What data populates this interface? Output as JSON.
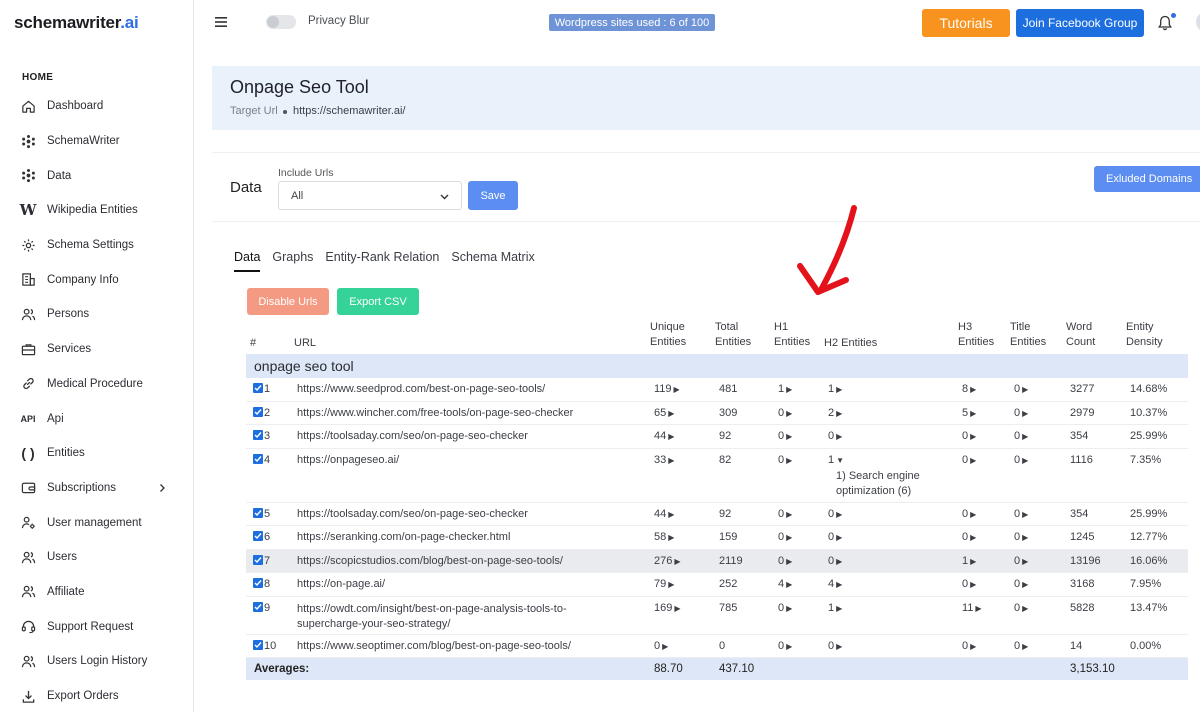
{
  "brand": {
    "name": "schemawriter",
    "suffix": ".ai"
  },
  "sidebar": {
    "section": "HOME",
    "items": [
      {
        "label": "Dashboard",
        "icon": "home-icon"
      },
      {
        "label": "SchemaWriter",
        "icon": "cluster-icon"
      },
      {
        "label": "Data",
        "icon": "cluster-icon"
      },
      {
        "label": "Wikipedia Entities",
        "icon": "wikipedia-icon"
      },
      {
        "label": "Schema Settings",
        "icon": "gear-icon"
      },
      {
        "label": "Company Info",
        "icon": "building-icon"
      },
      {
        "label": "Persons",
        "icon": "users-icon"
      },
      {
        "label": "Services",
        "icon": "briefcase-icon"
      },
      {
        "label": "Medical Procedure",
        "icon": "link-icon"
      },
      {
        "label": "Api",
        "icon": "api-icon"
      },
      {
        "label": "Entities",
        "icon": "parentheses-icon"
      },
      {
        "label": "Subscriptions",
        "icon": "wallet-icon"
      },
      {
        "label": "User management",
        "icon": "user-gear-icon"
      },
      {
        "label": "Users",
        "icon": "users-icon"
      },
      {
        "label": "Affiliate",
        "icon": "users-icon"
      },
      {
        "label": "Support Request",
        "icon": "support-icon"
      },
      {
        "label": "Users Login History",
        "icon": "users-icon"
      },
      {
        "label": "Export Orders",
        "icon": "download-icon"
      }
    ]
  },
  "topbar": {
    "privacy_label": "Privacy Blur",
    "wp_badge": "Wordpress sites used : 6 of 100",
    "tutorials": "Tutorials",
    "facebook": "Join Facebook Group"
  },
  "header": {
    "title": "Onpage Seo Tool",
    "target_label": "Target Url",
    "target_url": "https://schemawriter.ai/"
  },
  "filter": {
    "section_title": "Data",
    "include_label": "Include Urls",
    "include_value": "All",
    "save": "Save",
    "excluded": "Exluded Domains"
  },
  "tabs": [
    "Data",
    "Graphs",
    "Entity-Rank Relation",
    "Schema Matrix"
  ],
  "actions": {
    "disable": "Disable Urls",
    "export": "Export CSV"
  },
  "table": {
    "headers": {
      "num": "#",
      "url": "URL",
      "unique": [
        "Unique",
        "Entities"
      ],
      "total": [
        "Total",
        "Entities"
      ],
      "h1": [
        "H1",
        "Entities"
      ],
      "h2": "H2 Entities",
      "h3": [
        "H3",
        "Entities"
      ],
      "title": [
        "Title",
        "Entities"
      ],
      "words": [
        "Word",
        "Count"
      ],
      "density": [
        "Entity",
        "Density"
      ]
    },
    "group": "onpage seo tool",
    "rows": [
      {
        "n": "1",
        "url": "https://www.seedprod.com/best-on-page-seo-tools/",
        "unique": "119",
        "total": "481",
        "h1": "1",
        "h2": "1",
        "h3": "8",
        "title": "0",
        "words": "3277",
        "density": "14.68%"
      },
      {
        "n": "2",
        "url": "https://www.wincher.com/free-tools/on-page-seo-checker",
        "unique": "65",
        "total": "309",
        "h1": "0",
        "h2": "2",
        "h3": "5",
        "title": "0",
        "words": "2979",
        "density": "10.37%"
      },
      {
        "n": "3",
        "url": "https://toolsaday.com/seo/on-page-seo-checker",
        "unique": "44",
        "total": "92",
        "h1": "0",
        "h2": "0",
        "h3": "0",
        "title": "0",
        "words": "354",
        "density": "25.99%"
      },
      {
        "n": "4",
        "url": "https://onpageseo.ai/",
        "unique": "33",
        "total": "82",
        "h1": "0",
        "h2": "1",
        "h2_open": true,
        "h2_detail": [
          "1) Search engine",
          "optimization (6)"
        ],
        "h3": "0",
        "title": "0",
        "words": "1116",
        "density": "7.35%"
      },
      {
        "n": "5",
        "url": "https://toolsaday.com/seo/on-page-seo-checker",
        "unique": "44",
        "total": "92",
        "h1": "0",
        "h2": "0",
        "h3": "0",
        "title": "0",
        "words": "354",
        "density": "25.99%"
      },
      {
        "n": "6",
        "url": "https://seranking.com/on-page-checker.html",
        "unique": "58",
        "total": "159",
        "h1": "0",
        "h2": "0",
        "h3": "0",
        "title": "0",
        "words": "1245",
        "density": "12.77%"
      },
      {
        "n": "7",
        "url": "https://scopicstudios.com/blog/best-on-page-seo-tools/",
        "unique": "276",
        "total": "2119",
        "h1": "0",
        "h2": "0",
        "h3": "1",
        "title": "0",
        "words": "13196",
        "density": "16.06%",
        "highlight": true
      },
      {
        "n": "8",
        "url": "https://on-page.ai/",
        "unique": "79",
        "total": "252",
        "h1": "4",
        "h2": "4",
        "h3": "0",
        "title": "0",
        "words": "3168",
        "density": "7.95%"
      },
      {
        "n": "9",
        "url": "https://owdt.com/insight/best-on-page-analysis-tools-to-supercharge-your-seo-strategy/",
        "url_lines": [
          "https://owdt.com/insight/best-on-page-analysis-tools-to-",
          "supercharge-your-seo-strategy/"
        ],
        "unique": "169",
        "total": "785",
        "h1": "0",
        "h2": "1",
        "h3": "11",
        "title": "0",
        "words": "5828",
        "density": "13.47%"
      },
      {
        "n": "10",
        "url": "https://www.seoptimer.com/blog/best-on-page-seo-tools/",
        "unique": "0",
        "total": "0",
        "h1": "0",
        "h2": "0",
        "h3": "0",
        "title": "0",
        "words": "14",
        "density": "0.00%"
      }
    ],
    "averages": {
      "label": "Averages:",
      "unique": "88.70",
      "total": "437.10",
      "words": "3,153.10"
    }
  },
  "colors": {
    "accent": "#1d6fe0",
    "orange": "#f7931e",
    "green": "#36d399",
    "salmon": "#f49a82",
    "annotation": "#e3121b"
  }
}
